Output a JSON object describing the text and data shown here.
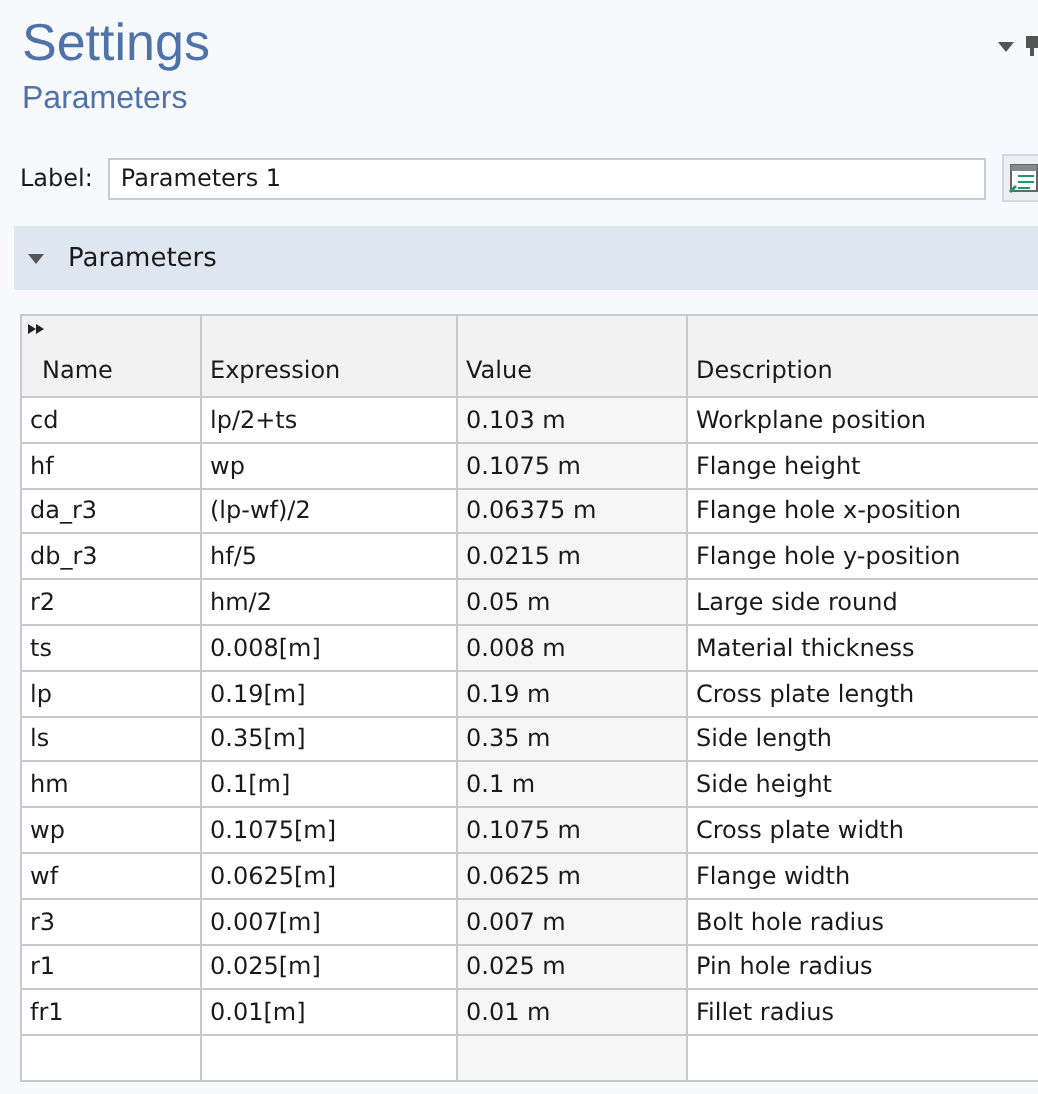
{
  "window": {
    "title": "Settings",
    "subtitle": "Parameters"
  },
  "label_field": {
    "label": "Label:",
    "value": "Parameters 1"
  },
  "section": {
    "title": "Parameters",
    "expanded": true
  },
  "table": {
    "columns": [
      "Name",
      "Expression",
      "Value",
      "Description"
    ],
    "rows": [
      [
        "cd",
        "lp/2+ts",
        "0.103 m",
        "Workplane position"
      ],
      [
        "hf",
        "wp",
        "0.1075 m",
        "Flange height"
      ],
      [
        "da_r3",
        "(lp-wf)/2",
        "0.06375 m",
        "Flange hole x-position"
      ],
      [
        "db_r3",
        "hf/5",
        "0.0215 m",
        "Flange hole y-position"
      ],
      [
        "r2",
        "hm/2",
        "0.05 m",
        "Large side round"
      ],
      [
        "ts",
        "0.008[m]",
        "0.008 m",
        "Material thickness"
      ],
      [
        "lp",
        "0.19[m]",
        "0.19 m",
        "Cross plate length"
      ],
      [
        "ls",
        "0.35[m]",
        "0.35 m",
        "Side length"
      ],
      [
        "hm",
        "0.1[m]",
        "0.1 m",
        "Side height"
      ],
      [
        "wp",
        "0.1075[m]",
        "0.1075 m",
        "Cross plate width"
      ],
      [
        "wf",
        "0.0625[m]",
        "0.0625 m",
        "Flange width"
      ],
      [
        "r3",
        "0.007[m]",
        "0.007 m",
        "Bolt hole radius"
      ],
      [
        "r1",
        "0.025[m]",
        "0.025 m",
        "Pin hole radius"
      ],
      [
        "fr1",
        "0.01[m]",
        "0.01 m",
        "Fillet radius"
      ]
    ]
  }
}
